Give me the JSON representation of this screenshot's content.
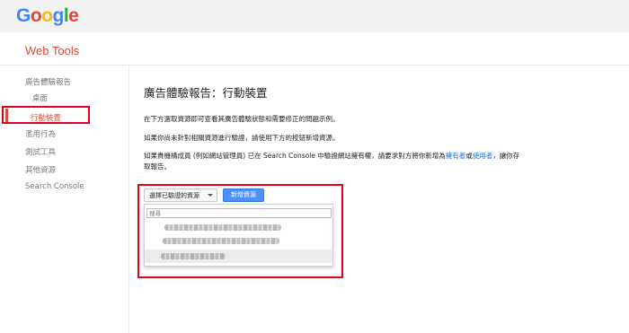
{
  "header": {
    "logo_letters": [
      {
        "ch": "G",
        "color": "#4285F4"
      },
      {
        "ch": "o",
        "color": "#EA4335"
      },
      {
        "ch": "o",
        "color": "#FBBC05"
      },
      {
        "ch": "g",
        "color": "#4285F4"
      },
      {
        "ch": "l",
        "color": "#34A853"
      },
      {
        "ch": "e",
        "color": "#EA4335"
      }
    ],
    "product_name": "Web Tools"
  },
  "sidebar": {
    "items": [
      {
        "label": "廣告體驗報告"
      },
      {
        "label": "桌面"
      },
      {
        "label": "行動裝置",
        "selected": true
      },
      {
        "label": "濫用行為"
      },
      {
        "label": "測試工具"
      },
      {
        "label": "其他資源"
      },
      {
        "label": "Search Console"
      }
    ]
  },
  "main": {
    "title": "廣告體驗報告：行動裝置",
    "para1": "在下方選取資源即可查看其廣告體驗狀態和需要修正的問題示例。",
    "para2": "如果你尚未針對相關資源進行驗證，請使用下方的按鈕新增資源。",
    "para3_before": "如果貴機構成員 (例如網站管理員) 已在 Search Console 中驗證網站擁有權，請要求對方將你新增為",
    "link_owner": "擁有者",
    "or_text": "或",
    "link_user": "使用者",
    "para3_after": "，讓你存取報告。",
    "dropdown_label": "選擇已驗證的資源",
    "add_button": "新增資源",
    "search_placeholder": "搜尋"
  },
  "colors": {
    "accent_red": "#dd4b39",
    "highlight_red": "#e2001a",
    "button_blue": "#4d90fe",
    "link_blue": "#1a73e8"
  }
}
